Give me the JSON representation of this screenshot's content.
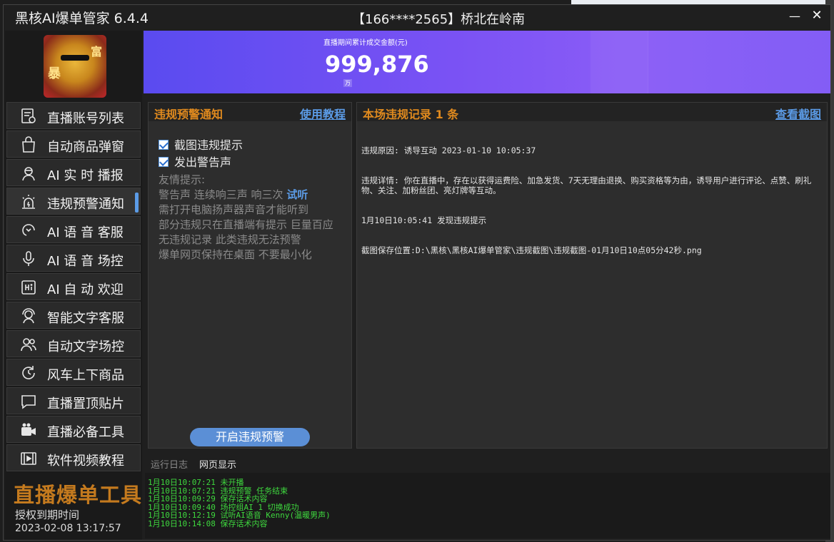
{
  "window": {
    "app_title": "黑核AI爆单管家 6.4.4",
    "user_title": "【166****2565】桥北在岭南",
    "minimize": "—",
    "close": "✕"
  },
  "sidebar": {
    "avatar_chars": [
      "暴",
      "富"
    ],
    "items": [
      {
        "label": "直播账号列表",
        "icon": "account-list-icon"
      },
      {
        "label": "自动商品弹窗",
        "icon": "shopping-bag-icon"
      },
      {
        "label": "AI 实 时 播报",
        "icon": "broadcaster-icon"
      },
      {
        "label": "违规预警通知",
        "icon": "alarm-icon",
        "active": true
      },
      {
        "label": "AI 语 音 客服",
        "icon": "voice-service-icon"
      },
      {
        "label": "AI 语 音 场控",
        "icon": "microphone-icon"
      },
      {
        "label": "AI 自 动 欢迎",
        "icon": "hi-icon"
      },
      {
        "label": "智能文字客服",
        "icon": "headset-icon"
      },
      {
        "label": "自动文字场控",
        "icon": "users-icon"
      },
      {
        "label": "风车上下商品",
        "icon": "refresh-icon"
      },
      {
        "label": "直播置顶贴片",
        "icon": "pin-message-icon"
      },
      {
        "label": "直播必备工具",
        "icon": "camera-tools-icon"
      },
      {
        "label": "软件视频教程",
        "icon": "video-tutorial-icon"
      }
    ],
    "brand": "直播爆单工具",
    "expire_label": "授权到期时间",
    "expire_date": "2023-02-08 13:17:57"
  },
  "banner": {
    "caption": "直播期间累计成交金额(元)",
    "value": "999,876",
    "unit": "万"
  },
  "warn_panel": {
    "title": "违规预警通知",
    "tutorial_link": "使用教程",
    "checkboxes": [
      {
        "label": "截图违规提示",
        "checked": true
      },
      {
        "label": "发出警告声",
        "checked": true
      }
    ],
    "tips_title": "友情提示:",
    "tip_sound": "警告声 连续响三声 响三次",
    "try_listen": "试听",
    "tips": [
      "需打开电脑扬声器声音才能听到",
      "部分违规只在直播端有提示 巨量百应",
      "无违规记录 此类违规无法预警",
      "爆单网页保持在桌面 不要最小化"
    ],
    "start_button": "开启违规预警"
  },
  "record_panel": {
    "title": "本场违规记录 1 条",
    "screenshot_link": "查看截图",
    "lines": [
      "违规原因: 诱导互动 2023-01-10 10:05:37",
      "违规详情: 你在直播中，存在以获得运费险、加急发货、7天无理由退换、购买资格等为由，诱导用户进行评论、点赞、刷礼物、关注、加粉丝团、亮灯牌等互动。",
      "1月10日10:05:41 发现违规提示",
      "截图保存位置:D:\\黑核\\黑核AI爆单管家\\违规截图\\违规截图-01月10日10点05分42秒.png"
    ]
  },
  "log": {
    "tabs": [
      "运行日志",
      "网页显示"
    ],
    "lines": [
      "1月10日10:07:21 未开播",
      "1月10日10:07:21 违规预警 任务结束",
      "1月10日10:09:29 保存话术内容",
      "1月10日10:09:40 场控组AI 1 切换成功",
      "1月10日10:12:19 试听AI语音 Kenny(温暖男声)",
      "1月10日10:14:08 保存话术内容"
    ]
  },
  "colors": {
    "accent_orange": "#e08a1e",
    "link_blue": "#5b9be6",
    "log_green": "#3ed83e",
    "banner_purple": "#7a52f4"
  }
}
